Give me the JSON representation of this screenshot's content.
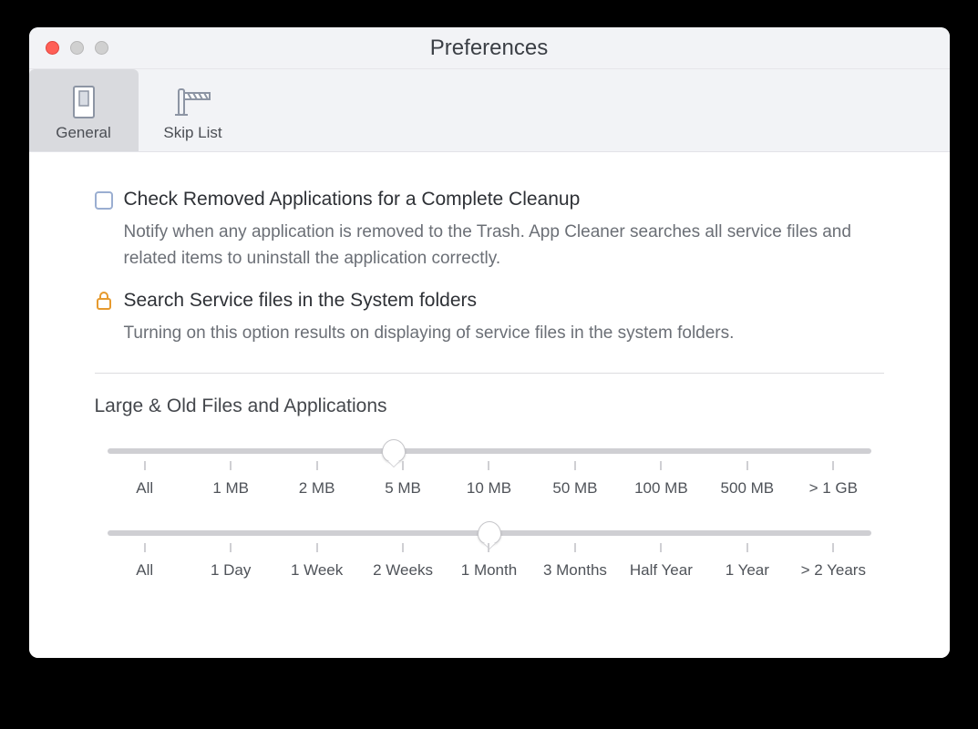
{
  "window": {
    "title": "Preferences"
  },
  "tabs": {
    "general": "General",
    "skiplist": "Skip List"
  },
  "prefs": {
    "check_removed": {
      "title": "Check Removed Applications for a Complete Cleanup",
      "desc": "Notify when any application is removed to the Trash. App Cleaner searches all service files and related items to uninstall the application correctly."
    },
    "search_system": {
      "title": "Search Service files in the System folders",
      "desc": "Turning on this option results on displaying of service files in the system folders."
    }
  },
  "section": {
    "heading": "Large & Old Files and Applications"
  },
  "slider_size": {
    "labels": [
      "All",
      "1 MB",
      "2 MB",
      "5 MB",
      "10 MB",
      "50 MB",
      "100 MB",
      "500 MB",
      "> 1 GB"
    ],
    "selected_index": 3
  },
  "slider_age": {
    "labels": [
      "All",
      "1 Day",
      "1 Week",
      "2 Weeks",
      "1 Month",
      "3 Months",
      "Half Year",
      "1 Year",
      "> 2 Years"
    ],
    "selected_index": 4
  }
}
